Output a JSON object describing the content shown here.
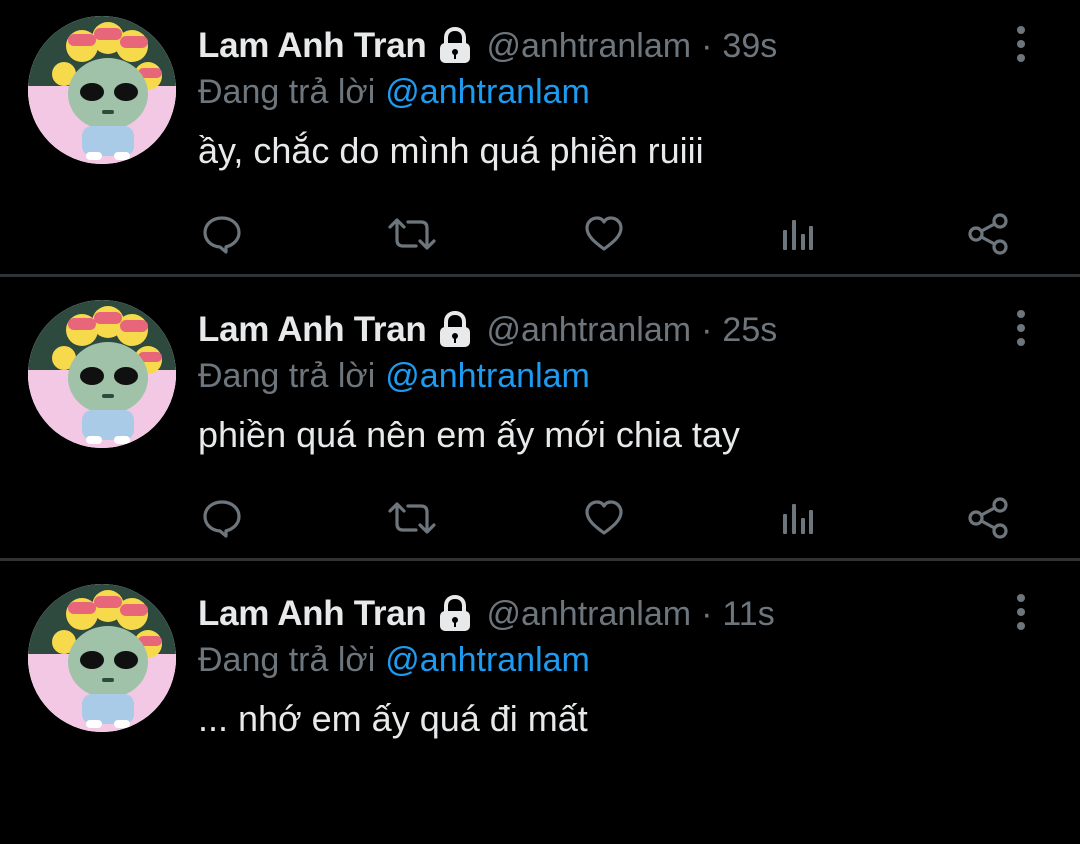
{
  "colors": {
    "background": "#000000",
    "text_primary": "#e7e9ea",
    "text_secondary": "#6e767d",
    "mention": "#1d9bf0",
    "divider": "#2f3336"
  },
  "icons": {
    "lock": "lock-icon",
    "more": "more-vertical-icon",
    "reply": "reply-icon",
    "retweet": "retweet-icon",
    "like": "heart-icon",
    "views": "analytics-icon",
    "share": "share-icon"
  },
  "tweets": [
    {
      "display_name": "Lam Anh Tran",
      "handle": "@anhtranlam",
      "separator": "·",
      "time": "39s",
      "reply_prefix": "Đang trả lời",
      "reply_mention": "@anhtranlam",
      "text": "ầy, chắc do mình quá phiền ruiii"
    },
    {
      "display_name": "Lam Anh Tran",
      "handle": "@anhtranlam",
      "separator": "·",
      "time": "25s",
      "reply_prefix": "Đang trả lời",
      "reply_mention": "@anhtranlam",
      "text": "phiền quá nên em ấy mới chia tay"
    },
    {
      "display_name": "Lam Anh Tran",
      "handle": "@anhtranlam",
      "separator": "·",
      "time": "11s",
      "reply_prefix": "Đang trả lời",
      "reply_mention": "@anhtranlam",
      "text": "... nhớ em ấy quá đi mất"
    }
  ]
}
